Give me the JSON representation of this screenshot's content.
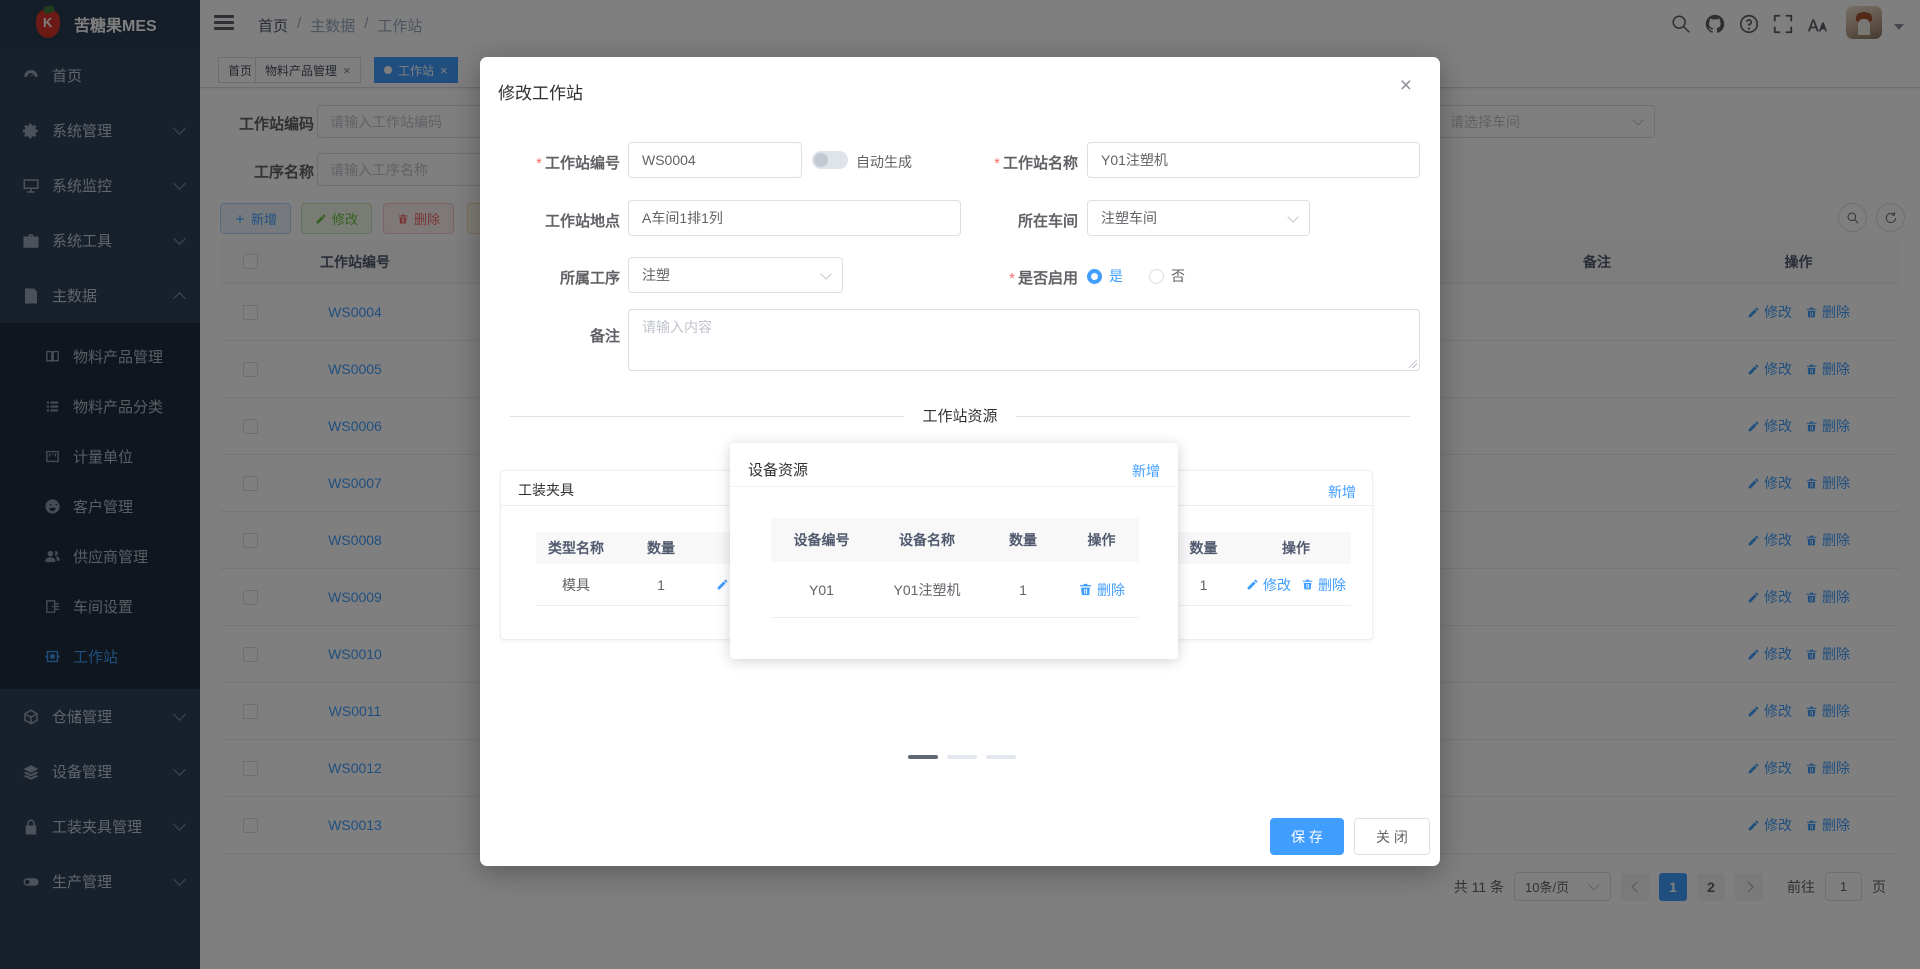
{
  "app": {
    "name": "苦糖果MES"
  },
  "breadcrumb": {
    "items": [
      "首页",
      "主数据",
      "工作站"
    ],
    "sep": "/"
  },
  "tabs": [
    {
      "label": "首页"
    },
    {
      "label": "物料产品管理"
    },
    {
      "label": "工作站"
    }
  ],
  "glyphs": {
    "close": "×"
  },
  "sidebar": {
    "items": [
      {
        "label": "首页"
      },
      {
        "label": "系统管理"
      },
      {
        "label": "系统监控"
      },
      {
        "label": "系统工具"
      },
      {
        "label": "主数据"
      },
      {
        "label": "仓储管理"
      },
      {
        "label": "设备管理"
      },
      {
        "label": "工装夹具管理"
      },
      {
        "label": "生产管理"
      }
    ],
    "submenu": [
      "物料产品管理",
      "物料产品分类",
      "计量单位",
      "客户管理",
      "供应商管理",
      "车间设置",
      "工作站"
    ]
  },
  "filters": {
    "code_label": "工作站编码",
    "code_placeholder": "请输入工作站编码",
    "process_label": "工序名称",
    "process_placeholder": "请输入工序名称",
    "workshop_placeholder": "请选择车间"
  },
  "toolbar": {
    "add": "新增",
    "edit": "修改",
    "delete": "删除"
  },
  "labels": {
    "edit": "修改",
    "delete": "删除",
    "add": "新增"
  },
  "table": {
    "id_header": "工作站编号",
    "remark_header": "备注",
    "action_header": "操作",
    "rows": [
      "WS0004",
      "WS0005",
      "WS0006",
      "WS0007",
      "WS0008",
      "WS0009",
      "WS0010",
      "WS0011",
      "WS0012",
      "WS0013"
    ]
  },
  "pagination": {
    "total": "共 11 条",
    "page_size": "10条/页",
    "page1": "1",
    "page2": "2",
    "goto": "前往",
    "goto_value": "1",
    "unit": "页"
  },
  "modal": {
    "title": "修改工作站",
    "required_mark": "*",
    "fields": {
      "code_label": "工作站编号",
      "code_value": "WS0004",
      "auto_label": "自动生成",
      "name_label": "工作站名称",
      "name_value": "Y01注塑机",
      "location_label": "工作站地点",
      "location_value": "A车间1排1列",
      "workshop_label": "所在车间",
      "workshop_value": "注塑车间",
      "process_label": "所属工序",
      "process_value": "注塑",
      "enabled_label": "是否启用",
      "enabled_yes": "是",
      "enabled_no": "否",
      "remark_label": "备注",
      "remark_placeholder": "请输入内容"
    },
    "resources": {
      "divider": "工作站资源",
      "fixture_panel": {
        "title": "工装夹具",
        "col_type": "类型名称",
        "col_qty": "数量",
        "col_action": "操作",
        "row_type": "模具",
        "row_qty": "1"
      },
      "device_panel": {
        "title": "设备资源",
        "col_code": "设备编号",
        "col_name": "设备名称",
        "col_qty": "数量",
        "col_action": "操作",
        "row_code": "Y01",
        "row_name": "Y01注塑机",
        "row_qty": "1"
      },
      "right_panel": {
        "col_qty": "数量",
        "col_action": "操作",
        "row_qty": "1"
      }
    },
    "footer": {
      "save": "保 存",
      "close": "关 闭"
    }
  },
  "colors": {
    "primary": "#409eff",
    "sidebar": "#304156",
    "submenu": "#1f2d3d"
  }
}
